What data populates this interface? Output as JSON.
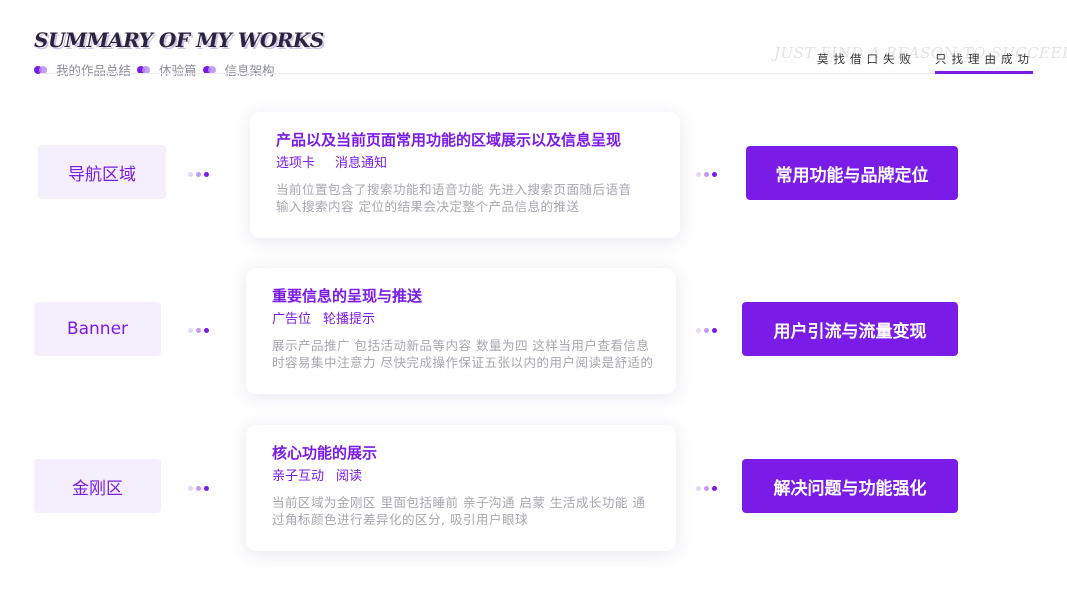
{
  "header": {
    "title": "SUMMARY OF MY WORKS",
    "crumbs": [
      "我的作品总结",
      "体验篇",
      "信息架构"
    ],
    "slogan_bg": "JUST FIND A REASON TO SUCCEED",
    "slogan_left": "莫找借口失败",
    "slogan_right": "只找理由成功"
  },
  "rows": [
    {
      "left": "导航区域",
      "card_title": "产品以及当前页面常用功能的区域展示以及信息呈现",
      "tags": [
        "选项卡",
        "消息通知"
      ],
      "desc_lines": [
        "当前位置包含了搜索功能和语音功能 先进入搜索页面随后语音",
        "输入搜索内容 定位的结果会决定整个产品信息的推送"
      ],
      "right": "常用功能与品牌定位"
    },
    {
      "left": "Banner",
      "card_title": "重要信息的呈现与推送",
      "tags": [
        "广告位",
        "轮播提示"
      ],
      "desc_lines": [
        "展示产品推广 包括活动新品等内容 数量为四 这样当用户查看信息",
        "时容易集中注意力 尽快完成操作保证五张以内的用户阅读是舒适的"
      ],
      "right": "用户引流与流量变现"
    },
    {
      "left": "金刚区",
      "card_title": "核心功能的展示",
      "tags": [
        "亲子互动",
        "阅读"
      ],
      "desc_lines": [
        "当前区域为金刚区 里面包括睡前 亲子沟通 启蒙 生活成长功能 通",
        "过角标颜色进行差异化的区分, 吸引用户眼球"
      ],
      "right": "解决问题与功能强化"
    }
  ],
  "colors": {
    "accent": "#7a1be8",
    "label_bg": "#f5effd",
    "muted": "#a7a7b0"
  }
}
